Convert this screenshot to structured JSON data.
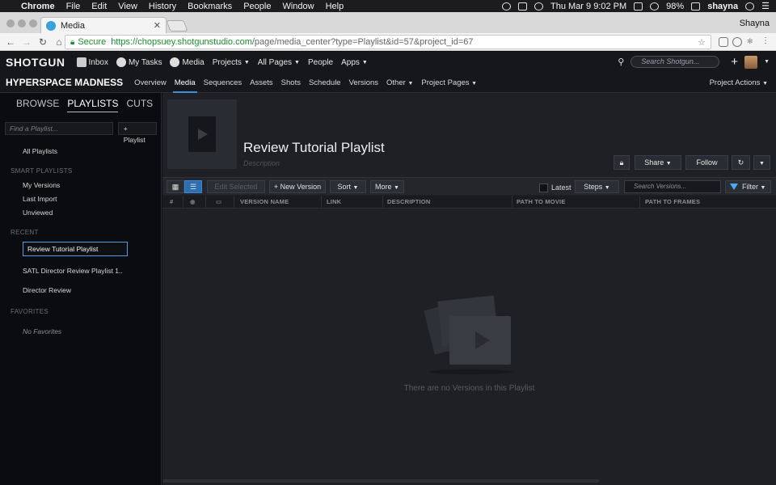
{
  "mac_menu": {
    "app": "Chrome",
    "items": [
      "File",
      "Edit",
      "View",
      "History",
      "Bookmarks",
      "People",
      "Window",
      "Help"
    ],
    "datetime": "Thu Mar 9  9:02 PM",
    "battery": "98%",
    "user": "shayna"
  },
  "browser": {
    "tab_title": "Media",
    "profile": "Shayna",
    "secure_label": "Secure",
    "url_host": "https://chopsuey.shotgunstudio.com",
    "url_path": "/page/media_center?type=Playlist&id=57&project_id=67"
  },
  "sg_nav": {
    "logo": "SHOTGUN",
    "inbox": "Inbox",
    "my_tasks": "My Tasks",
    "media": "Media",
    "projects": "Projects",
    "all_pages": "All Pages",
    "people": "People",
    "apps": "Apps",
    "search_placeholder": "Search Shotgun..."
  },
  "project_nav": {
    "project": "HYPERSPACE MADNESS",
    "tabs": [
      "Overview",
      "Media",
      "Sequences",
      "Assets",
      "Shots",
      "Schedule",
      "Versions",
      "Other",
      "Project Pages"
    ],
    "active": "Media",
    "project_actions": "Project Actions"
  },
  "sidebar": {
    "tabs": [
      "BROWSE",
      "PLAYLISTS",
      "CUTS"
    ],
    "find_placeholder": "Find a Playlist...",
    "add_button": "+ Playlist",
    "all_playlists": "All Playlists",
    "smart_header": "SMART PLAYLISTS",
    "smart_items": [
      "My Versions",
      "Last Import",
      "Unviewed"
    ],
    "recent_header": "RECENT",
    "recent_selected": "Review Tutorial Playlist",
    "recent_items": [
      "SATL Director Review Playlist 1..",
      "Director Review"
    ],
    "favorites_header": "FAVORITES",
    "favorites_empty": "No Favorites"
  },
  "playlist": {
    "title": "Review Tutorial Playlist",
    "description_placeholder": "Description",
    "share": "Share",
    "follow": "Follow"
  },
  "versions_toolbar": {
    "edit_selected": "Edit Selected",
    "new_version": "+ New Version",
    "sort": "Sort",
    "more": "More",
    "latest": "Latest",
    "steps": "Steps",
    "search_placeholder": "Search Versions...",
    "filter": "Filter"
  },
  "columns": [
    "#",
    "VERSION NAME",
    "LINK",
    "DESCRIPTION",
    "PATH TO MOVIE",
    "PATH TO FRAMES"
  ],
  "empty_message": "There are no Versions in this Playlist",
  "colors": {
    "accent": "#3b8fd6",
    "secure": "#1a8f2b",
    "background": "#1f2026"
  }
}
